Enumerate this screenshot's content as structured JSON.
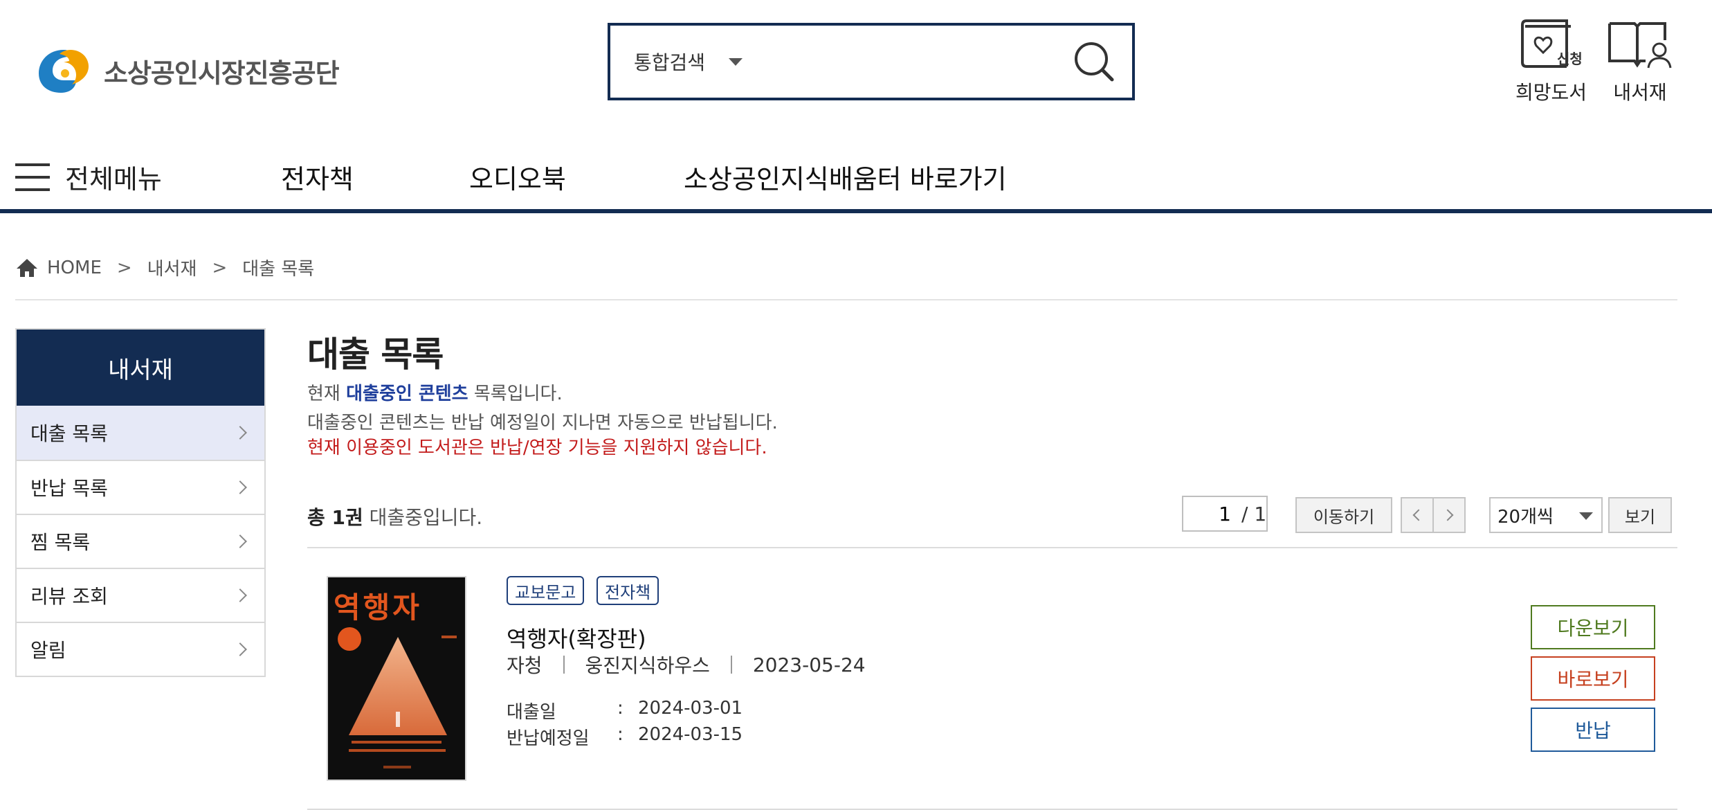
{
  "header": {
    "logo_text": "소상공인시장진흥공단",
    "search": {
      "scope": "통합검색",
      "value": "",
      "placeholder": ""
    },
    "utils": [
      {
        "label": "희망도서",
        "badge": "신청"
      },
      {
        "label": "내서재"
      }
    ]
  },
  "gnb": {
    "all_menu": "전체메뉴",
    "items": [
      "전자책",
      "오디오북",
      "소상공인지식배움터 바로가기"
    ]
  },
  "breadcrumb": [
    "HOME",
    "내서재",
    "대출 목록"
  ],
  "sidebar": {
    "title": "내서재",
    "items": [
      {
        "label": "대출 목록",
        "active": true
      },
      {
        "label": "반납 목록"
      },
      {
        "label": "찜 목록"
      },
      {
        "label": "리뷰 조회"
      },
      {
        "label": "알림"
      }
    ]
  },
  "main": {
    "title": "대출 목록",
    "desc1_pre": "현재 ",
    "desc1_hl": "대출중인 콘텐츠",
    "desc1_post": " 목록입니다.",
    "desc2": "대출중인 콘텐츠는 반납 예정일이 지나면 자동으로 반납됩니다.",
    "desc3": "현재 이용중인 도서관은 반납/연장 기능을 지원하지 않습니다.",
    "count_pre": "총 1권",
    "count_post": " 대출중입니다.",
    "pager": {
      "current": "1",
      "total": "/ 1",
      "go": "이동하기"
    },
    "per_page": "20개씩",
    "view_button": "보기"
  },
  "book": {
    "cover_title": "역행자",
    "tags": [
      "교보문고",
      "전자책"
    ],
    "title": "역행자(확장판)",
    "author": "자청",
    "publisher": "웅진지식하우스",
    "pub_date": "2023-05-24",
    "loan_label": "대출일",
    "loan_date": "2024-03-01",
    "due_label": "반납예정일",
    "due_date": "2024-03-15",
    "colon": ":",
    "actions": {
      "download": "다운보기",
      "view": "바로보기",
      "return": "반납"
    }
  },
  "colors": {
    "navy": "#132c52",
    "accent_blue": "#1f3f9c",
    "warning_red": "#c31b1b"
  }
}
